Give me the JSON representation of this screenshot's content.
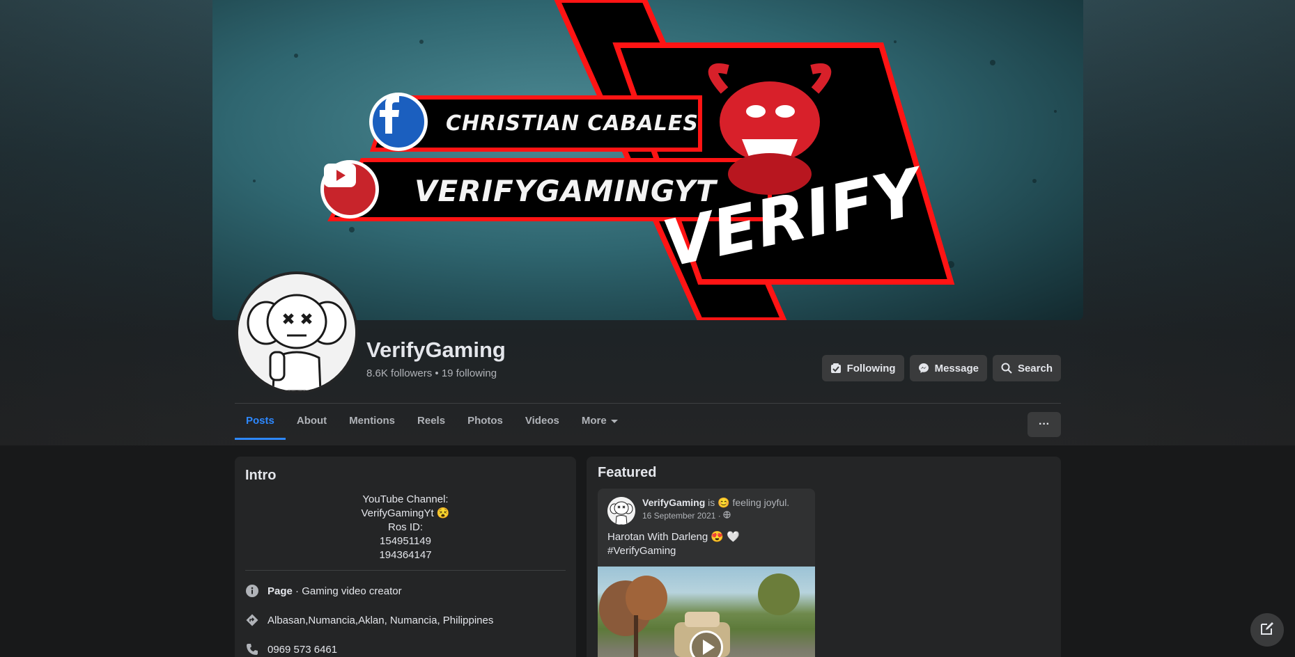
{
  "cover": {
    "creator_name": "CHRISTIAN CABALES",
    "channel_name": "VERIFYGAMINGYT",
    "brand_text": "VERIFY"
  },
  "profile": {
    "name": "VerifyGaming",
    "followers": "8.6K followers",
    "separator": "•",
    "following": "19 following"
  },
  "actions": {
    "following_label": "Following",
    "message_label": "Message",
    "search_label": "Search",
    "more_options_label": "···"
  },
  "tabs": [
    {
      "label": "Posts",
      "active": true
    },
    {
      "label": "About"
    },
    {
      "label": "Mentions"
    },
    {
      "label": "Reels"
    },
    {
      "label": "Photos"
    },
    {
      "label": "Videos"
    },
    {
      "label": "More"
    }
  ],
  "intro": {
    "title": "Intro",
    "bio_lines": [
      "YouTube Channel:",
      "VerifyGamingYt 😵",
      "Ros ID:",
      "154951149",
      "194364147"
    ],
    "category_bold": "Page",
    "category_rest": " · Gaming video creator",
    "address": "Albasan,Numancia,Aklan, Numancia, Philippines",
    "phone": "0969 573 6461"
  },
  "featured": {
    "title": "Featured",
    "post": {
      "author": "VerifyGaming",
      "feeling_prefix": " is 😊 feeling joyful.",
      "date": "16 September 2021 · ",
      "text_line1": "Harotan With Darleng 😍 🤍",
      "text_line2": "#VerifyGaming"
    }
  },
  "colors": {
    "accent": "#2d88ff",
    "card_bg": "#242526",
    "page_bg": "#18191a",
    "button_bg": "#3a3b3c"
  },
  "icons": {
    "following": "following-icon",
    "message": "messenger-icon",
    "search": "search-icon",
    "info": "info-icon",
    "address": "directions-icon",
    "phone": "phone-icon",
    "compose": "compose-icon"
  }
}
